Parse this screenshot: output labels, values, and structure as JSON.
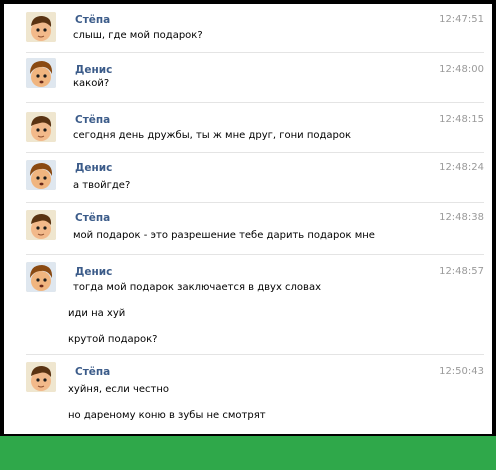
{
  "colors": {
    "author": "#3b5b89",
    "time": "#9a9a9a",
    "green_band": "#2fa84a"
  },
  "messages": [
    {
      "author": "Стёпа",
      "time": "12:47:51",
      "lines": [
        "слыш, где мой подарок?"
      ],
      "avatar": "stepa-avatar-icon"
    },
    {
      "author": "Денис",
      "time": "12:48:00",
      "lines": [
        "какой?"
      ],
      "avatar": "denis-avatar-icon"
    },
    {
      "author": "Стёпа",
      "time": "12:48:15",
      "lines": [
        "сегодня день дружбы, ты ж мне друг, гони подарок"
      ],
      "avatar": "stepa-avatar-icon"
    },
    {
      "author": "Денис",
      "time": "12:48:24",
      "lines": [
        "а твойгде?"
      ],
      "avatar": "denis-avatar-icon"
    },
    {
      "author": "Стёпа",
      "time": "12:48:38",
      "lines": [
        "мой подарок - это разрешение тебе дарить подарок мне"
      ],
      "avatar": "stepa-avatar-icon"
    },
    {
      "author": "Денис",
      "time": "12:48:57",
      "lines": [
        "тогда мой подарок заключается в двух словах",
        "иди на хуй",
        "крутой подарок?"
      ],
      "avatar": "denis-avatar-icon"
    },
    {
      "author": "Стёпа",
      "time": "12:50:43",
      "lines": [
        "хуйня, если честно",
        "но дареному коню в зубы не смотрят"
      ],
      "avatar": "stepa-avatar-icon"
    }
  ]
}
